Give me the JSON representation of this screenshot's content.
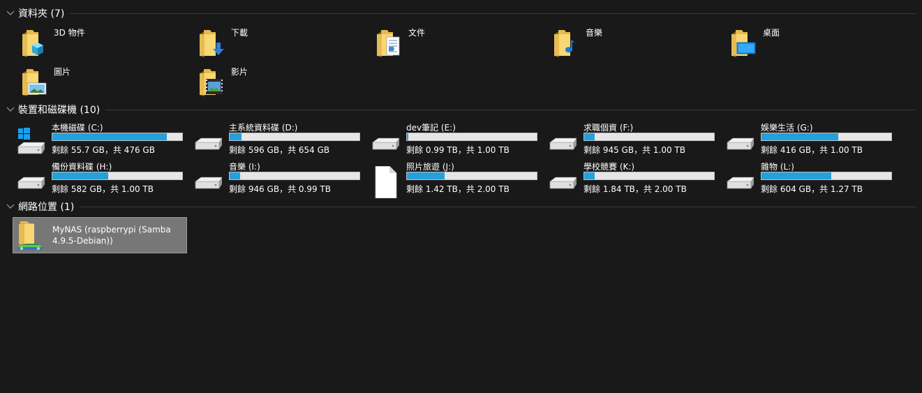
{
  "sections": {
    "folders": {
      "title": "資料夾 (7)"
    },
    "devices": {
      "title": "裝置和磁碟機 (10)"
    },
    "network": {
      "title": "網路位置 (1)"
    }
  },
  "folders": [
    {
      "name": "3D 物件",
      "icon": "3d-objects-folder-icon"
    },
    {
      "name": "下載",
      "icon": "downloads-folder-icon"
    },
    {
      "name": "文件",
      "icon": "documents-folder-icon"
    },
    {
      "name": "音樂",
      "icon": "music-folder-icon"
    },
    {
      "name": "桌面",
      "icon": "desktop-folder-icon"
    },
    {
      "name": "圖片",
      "icon": "pictures-folder-icon"
    },
    {
      "name": "影片",
      "icon": "videos-folder-icon"
    }
  ],
  "drives": [
    {
      "name": "本機磁碟 (C:)",
      "free": "剩餘 55.7 GB，共 476 GB",
      "used": 0.88,
      "icon": "windows-drive-icon"
    },
    {
      "name": "主系統資料碟 (D:)",
      "free": "剩餘 596 GB，共 654 GB",
      "used": 0.09,
      "icon": "hard-drive-icon"
    },
    {
      "name": "dev筆記 (E:)",
      "free": "剩餘 0.99 TB，共 1.00 TB",
      "used": 0.01,
      "icon": "hard-drive-icon"
    },
    {
      "name": "求職個資 (F:)",
      "free": "剩餘 945 GB，共 1.00 TB",
      "used": 0.08,
      "icon": "hard-drive-icon"
    },
    {
      "name": "娛樂生活 (G:)",
      "free": "剩餘 416 GB，共 1.00 TB",
      "used": 0.59,
      "icon": "hard-drive-icon"
    },
    {
      "name": "備份資料碟 (H:)",
      "free": "剩餘 582 GB，共 1.00 TB",
      "used": 0.43,
      "icon": "hard-drive-icon"
    },
    {
      "name": "音樂 (I:)",
      "free": "剩餘 946 GB，共 0.99 TB",
      "used": 0.08,
      "icon": "hard-drive-icon"
    },
    {
      "name": "照片旅遊 (J:)",
      "free": "剩餘 1.42 TB，共 2.00 TB",
      "used": 0.29,
      "icon": "blank-file-drive-icon"
    },
    {
      "name": "學校競賽 (K:)",
      "free": "剩餘 1.84 TB，共 2.00 TB",
      "used": 0.08,
      "icon": "hard-drive-icon"
    },
    {
      "name": "雜物 (L:)",
      "free": "剩餘 604 GB，共 1.27 TB",
      "used": 0.54,
      "icon": "hard-drive-icon"
    }
  ],
  "network_items": [
    {
      "name": "MyNAS (raspberrypi (Samba 4.9.5-Debian))",
      "icon": "network-folder-icon"
    }
  ],
  "colors": {
    "background": "#191919",
    "progress_fill": "#26a0da",
    "progress_track": "#e6e6e6",
    "selection": "#777777"
  }
}
